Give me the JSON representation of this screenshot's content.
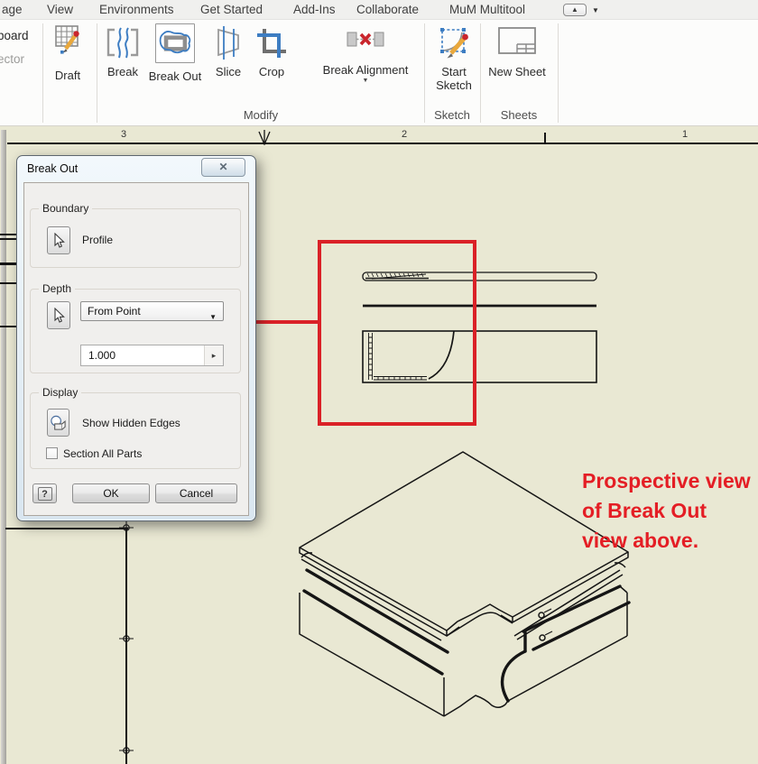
{
  "menubar": {
    "items": [
      {
        "label": "age"
      },
      {
        "label": "View"
      },
      {
        "label": "Environments"
      },
      {
        "label": "Get Started"
      },
      {
        "label": "Add-Ins"
      },
      {
        "label": "Collaborate"
      },
      {
        "label": "MuM Multitool"
      }
    ]
  },
  "ribbon": {
    "clipped": {
      "line1": "board",
      "line2": "ector"
    },
    "tools": {
      "draft": "Draft",
      "break": "Break",
      "break_out": "Break Out",
      "slice": "Slice",
      "crop": "Crop",
      "break_alignment": "Break Alignment",
      "start_sketch_line1": "Start",
      "start_sketch_line2": "Sketch",
      "new_sheet": "New Sheet"
    },
    "panels": {
      "modify": "Modify",
      "sketch": "Sketch",
      "sheets": "Sheets"
    }
  },
  "ruler": {
    "labels": [
      "3",
      "2",
      "1"
    ]
  },
  "dialog": {
    "title": "Break Out",
    "boundary": {
      "label": "Boundary",
      "profile": "Profile"
    },
    "depth": {
      "label": "Depth",
      "mode": "From Point",
      "value": "1.000"
    },
    "display": {
      "label": "Display",
      "show_hidden_edges": "Show Hidden Edges",
      "section_all_parts": "Section All Parts"
    },
    "buttons": {
      "ok": "OK",
      "cancel": "Cancel"
    }
  },
  "annotation": {
    "line1": "Prospective view",
    "line2": "of Break Out",
    "line3": "view above."
  },
  "icons": {
    "close": "✕",
    "help": "?",
    "combo_caret": "▼",
    "flyout_caret": "▸",
    "break_alignment_caret": "▼",
    "ribbon_toggle_up": "▲",
    "ribbon_toggle_caret": "▼"
  },
  "colors": {
    "annotation_red": "#da2127",
    "canvas_beige": "#e9e8d3",
    "accent_blue": "#3d7dc2"
  }
}
